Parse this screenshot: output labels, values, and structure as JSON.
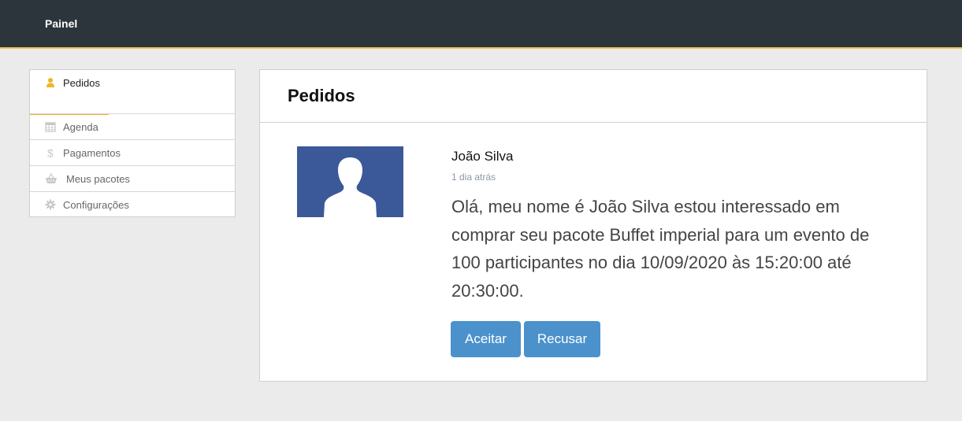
{
  "header": {
    "title": "Painel"
  },
  "sidebar": {
    "items": [
      {
        "label": "Pedidos",
        "icon": "user-icon"
      },
      {
        "label": "Agenda",
        "icon": "calendar-icon"
      },
      {
        "label": "Pagamentos",
        "icon": "dollar-icon"
      },
      {
        "label": "Meus pacotes",
        "icon": "basket-icon"
      },
      {
        "label": "Configurações",
        "icon": "gear-icon"
      }
    ]
  },
  "main": {
    "title": "Pedidos",
    "request": {
      "name": "João Silva",
      "time": "1 dia atrás",
      "message": "Olá, meu nome é João Silva estou interessado em comprar seu pacote Buffet imperial para um evento de 100 participantes no dia 10/09/2020 às 15:20:00 até 20:30:00.",
      "accept_label": "Aceitar",
      "reject_label": "Recusar"
    }
  },
  "colors": {
    "topbar": "#2c353b",
    "accent": "#f0b428",
    "button": "#4b92cc",
    "avatar_bg": "#3b5999"
  }
}
